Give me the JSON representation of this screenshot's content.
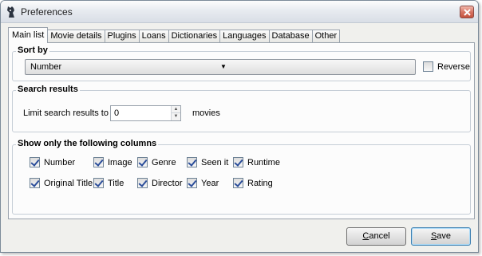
{
  "window": {
    "title": "Preferences"
  },
  "tabs": [
    {
      "label": "Main list",
      "active": true
    },
    {
      "label": "Movie details"
    },
    {
      "label": "Plugins"
    },
    {
      "label": "Loans"
    },
    {
      "label": "Dictionaries"
    },
    {
      "label": "Languages"
    },
    {
      "label": "Database"
    },
    {
      "label": "Other"
    }
  ],
  "sort_by": {
    "title": "Sort by",
    "selected": "Number",
    "reverse_label": "Reverse",
    "reverse_checked": false
  },
  "search_results": {
    "title": "Search results",
    "limit_label": "Limit search results to",
    "limit_value": "0",
    "unit": "movies"
  },
  "columns": {
    "title": "Show only the following columns",
    "items": [
      {
        "label": "Number",
        "checked": true
      },
      {
        "label": "Image",
        "checked": true
      },
      {
        "label": "Genre",
        "checked": true
      },
      {
        "label": "Seen it",
        "checked": true
      },
      {
        "label": "Runtime",
        "checked": true
      },
      {
        "label": "Original Title",
        "checked": true
      },
      {
        "label": "Title",
        "checked": true
      },
      {
        "label": "Director",
        "checked": true
      },
      {
        "label": "Year",
        "checked": true
      },
      {
        "label": "Rating",
        "checked": true
      }
    ]
  },
  "buttons": {
    "cancel": {
      "mnemonic": "C",
      "rest": "ancel"
    },
    "save": {
      "mnemonic": "S",
      "rest": "ave"
    }
  }
}
